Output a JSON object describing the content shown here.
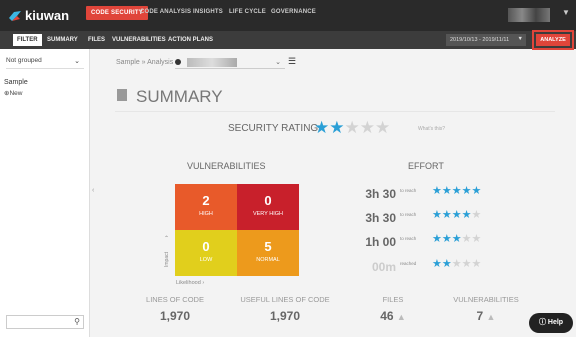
{
  "app": {
    "logo_text": "kiuwan"
  },
  "topnav": {
    "items": [
      "CODE SECURITY",
      "CODE ANALYSIS",
      "INSIGHTS",
      "LIFE CYCLE",
      "GOVERNANCE"
    ],
    "active": "CODE SECURITY"
  },
  "subnav": {
    "items": [
      "FILTER",
      "SUMMARY",
      "FILES",
      "VULNERABILITIES",
      "ACTION PLANS"
    ]
  },
  "date_range": "2019/10/13 - 2019/11/11",
  "analyze_label": "ANALYZE",
  "sidebar": {
    "group_select": "Not grouped",
    "app_name": "Sample",
    "new_label": "New",
    "search_placeholder": ""
  },
  "breadcrumb": "Sample » Analysis",
  "summary_title": "SUMMARY",
  "security_rating": {
    "label": "SECURITY RATING",
    "stars": 2,
    "max": 5,
    "help_link": "What's this?",
    "color": "#2a9fd6"
  },
  "vulnerabilities": {
    "title": "VULNERABILITIES",
    "cells": [
      {
        "count": "2",
        "label": "HIGH",
        "color": "#e85a2a"
      },
      {
        "count": "0",
        "label": "VERY HIGH",
        "color": "#c8202b"
      },
      {
        "count": "0",
        "label": "LOW",
        "color": "#e1cf1c"
      },
      {
        "count": "5",
        "label": "NORMAL",
        "color": "#ed9a1c"
      }
    ],
    "y_axis": "Impact",
    "x_axis": "Likelihood"
  },
  "effort": {
    "title": "EFFORT",
    "rows": [
      {
        "time": "3h 30",
        "note": "to reach",
        "stars": 5
      },
      {
        "time": "3h 30",
        "note": "to reach",
        "stars": 4
      },
      {
        "time": "1h 00",
        "note": "to reach",
        "stars": 3
      },
      {
        "time": "00m",
        "note": "reached",
        "stars": 2
      }
    ]
  },
  "metrics": [
    {
      "label": "LINES OF CODE",
      "value": "1,970",
      "trend": ""
    },
    {
      "label": "USEFUL LINES OF CODE",
      "value": "1,970",
      "trend": ""
    },
    {
      "label": "FILES",
      "value": "46",
      "trend": "▲"
    },
    {
      "label": "VULNERABILITIES",
      "value": "7",
      "trend": "▲"
    }
  ],
  "help_label": "Help",
  "colors": {
    "accent": "#e0453a",
    "star_on": "#2a9fd6",
    "star_off": "#d3d3d3"
  }
}
